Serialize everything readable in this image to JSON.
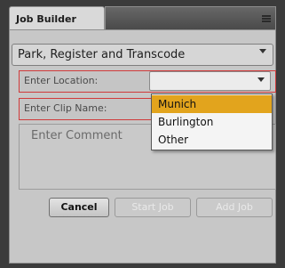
{
  "panel": {
    "tab_label": "Job Builder",
    "menu_icon": "hamburger-menu-icon"
  },
  "workflow": {
    "selected": "Park, Register and Transcode"
  },
  "location": {
    "label": "Enter Location:",
    "value": "",
    "options": [
      "Munich",
      "Burlington",
      "Other"
    ],
    "highlighted": "Munich"
  },
  "clip": {
    "label": "Enter Clip Name:"
  },
  "comment": {
    "placeholder": "Enter Comment"
  },
  "buttons": {
    "cancel": "Cancel",
    "start": "Start Job",
    "add": "Add Job"
  },
  "colors": {
    "highlight": "#e2a41d",
    "required_border": "#d03a3a"
  }
}
